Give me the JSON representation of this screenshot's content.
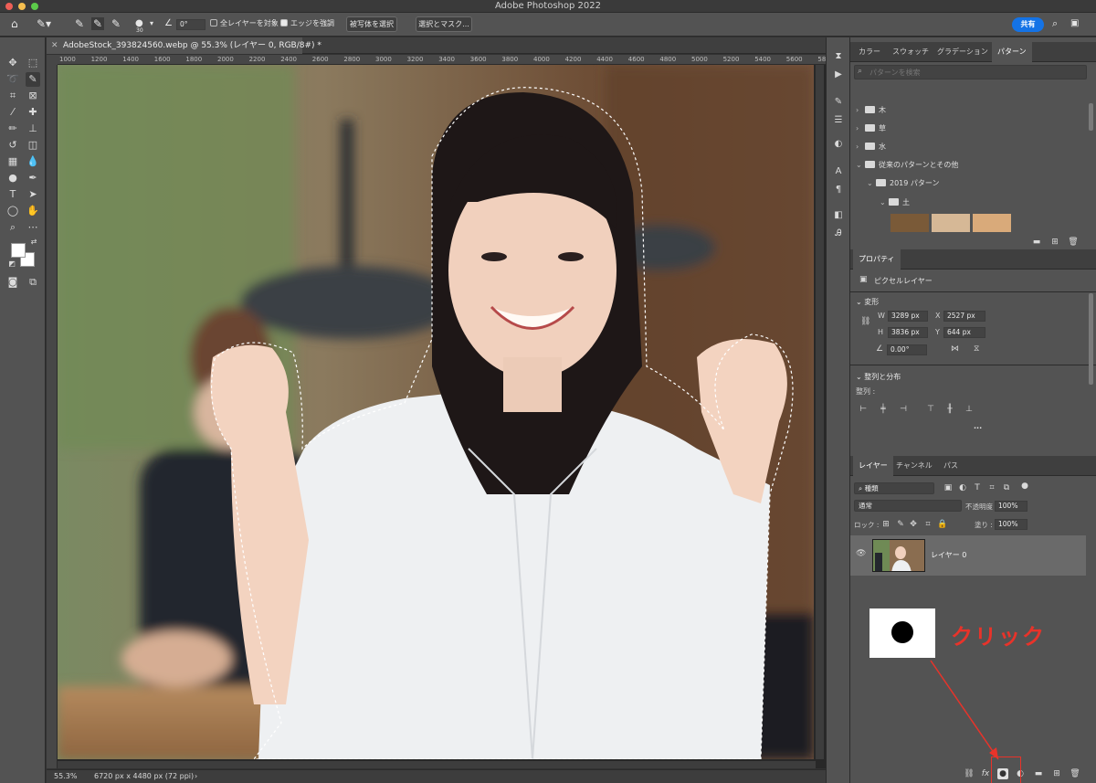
{
  "app": {
    "title": "Adobe Photoshop 2022"
  },
  "options": {
    "brush_size": "30",
    "angle": "0°",
    "sample_all_label": "全レイヤーを対象",
    "enhance_edge_label": "エッジを強調",
    "select_subject_label": "被写体を選択",
    "select_mask_label": "選択とマスク...",
    "share_label": "共有"
  },
  "document": {
    "tab_title": "AdobeStock_393824560.webp @ 55.3% (レイヤー 0, RGB/8#) *",
    "ruler_ticks": [
      "1000",
      "1200",
      "1400",
      "1600",
      "1800",
      "2000",
      "2200",
      "2400",
      "2600",
      "2800",
      "3000",
      "3200",
      "3400",
      "3600",
      "3800",
      "4000",
      "4200",
      "4400",
      "4600",
      "4800",
      "5000",
      "5200",
      "5400",
      "5600",
      "5800"
    ],
    "zoom": "55.3%",
    "doc_info": "6720 px x 4480 px (72 ppi)"
  },
  "patterns_panel": {
    "tabs": [
      "カラー",
      "スウォッチ",
      "グラデーション",
      "パターン"
    ],
    "search_placeholder": "パターンを検索",
    "tree": [
      "木",
      "草",
      "水",
      "従来のパターンとその他",
      "2019 パターン",
      "土"
    ]
  },
  "properties": {
    "tab": "プロパティ",
    "layer_type": "ピクセルレイヤー",
    "transform_title": "変形",
    "w_label": "W",
    "w_value": "3289 px",
    "x_label": "X",
    "x_value": "2527 px",
    "h_label": "H",
    "h_value": "3836 px",
    "y_label": "Y",
    "y_value": "644 px",
    "angle_value": "0.00°",
    "align_title": "整列と分布",
    "align_label": "整列 :",
    "more": "..."
  },
  "layers_panel": {
    "tabs": [
      "レイヤー",
      "チャンネル",
      "パス"
    ],
    "filter_value": "種類",
    "blend_mode": "通常",
    "opacity_label": "不透明度 :",
    "opacity_value": "100%",
    "lock_label": "ロック :",
    "fill_label": "塗り :",
    "fill_value": "100%",
    "layer_name": "レイヤー 0"
  },
  "annotation": {
    "click_text": "クリック",
    "color": "#e8332a"
  },
  "colors": {
    "accent": "#1473e6",
    "panel": "#535353",
    "dark": "#323232"
  }
}
